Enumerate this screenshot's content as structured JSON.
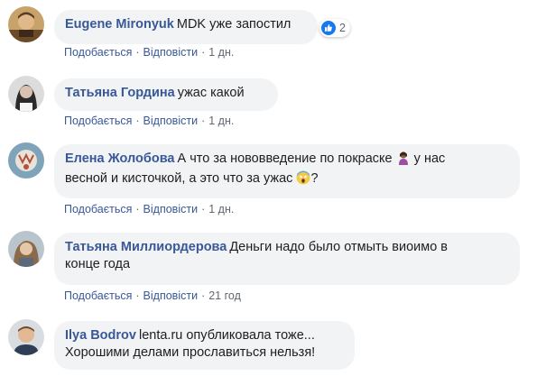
{
  "comments": [
    {
      "author": "Eugene Mironyuk",
      "text_lines": [
        "MDK уже запостил"
      ],
      "actions": {
        "like": "Подобається",
        "reply": "Відповісти",
        "time": "1 дн."
      },
      "reaction_count": "2"
    },
    {
      "author": "Татьяна Гордина",
      "text_lines": [
        "ужас какой"
      ],
      "actions": {
        "like": "Подобається",
        "reply": "Відповісти",
        "time": "1 дн."
      }
    },
    {
      "author": "Елена Жолобова",
      "text_lines": [
        "А что за нововведение по покраске",
        " у нас",
        "весной и кисточкой, а это что за ужас",
        "?"
      ],
      "actions": {
        "like": "Подобається",
        "reply": "Відповісти",
        "time": "1 дн."
      }
    },
    {
      "author": "Татьяна Миллиордерова",
      "text_lines": [
        "Деньги надо было отмыть виоимо в",
        "конце года"
      ],
      "actions": {
        "like": "Подобається",
        "reply": "Відповісти",
        "time": "21 год"
      }
    },
    {
      "author": "Ilya Bodrov",
      "text_lines": [
        "lenta.ru опубликовала тоже...",
        "Хорошими делами прославиться нельзя!"
      ]
    }
  ],
  "icons": {
    "reaction": "like-icon",
    "emoji_1": "woman-gesturing-emoji",
    "emoji_2": "screaming-face-emoji"
  },
  "colors": {
    "author_link": "#385898",
    "bubble_bg": "#f2f3f5",
    "meta_text": "#606770",
    "like_blue": "#1877f2"
  }
}
